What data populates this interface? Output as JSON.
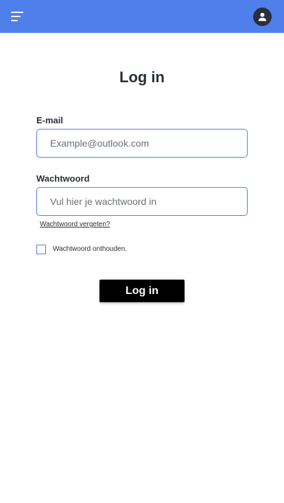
{
  "header": {
    "menu_icon": "hamburger-icon",
    "avatar_icon": "user-icon",
    "background_color": "#4F7FEA"
  },
  "form": {
    "title": "Log in",
    "email": {
      "label": "E-mail",
      "value": "",
      "placeholder": "Example@outlook.com"
    },
    "password": {
      "label": "Wachtwoord",
      "value": "",
      "placeholder": "Vul hier je wachtwoord in"
    },
    "forgot_link": "Wachtwoord vergeten?",
    "remember": {
      "label": "Wachtwoord onthouden.",
      "checked": false
    },
    "submit_label": "Log in"
  },
  "colors": {
    "accent": "#4F7FEA",
    "button_bg": "#000000",
    "text": "#2b2f3a"
  }
}
